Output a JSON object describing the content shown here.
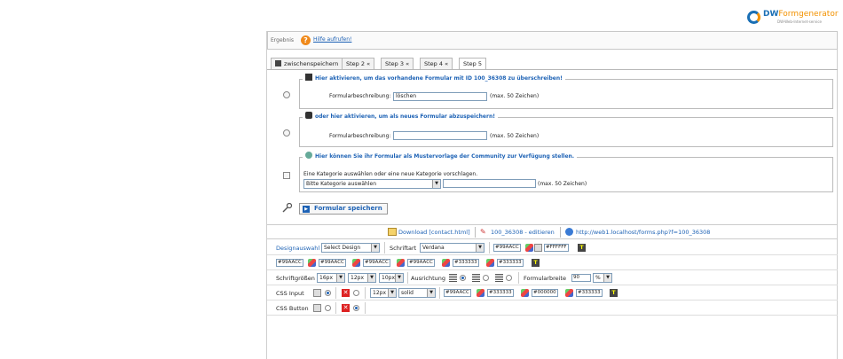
{
  "logo": {
    "brand_a": "DW",
    "brand_b": "Formgenerator",
    "tagline": "DW-Web-Internet-service"
  },
  "result": {
    "label": "Ergebnis",
    "help_link": "Hilfe aufrufen!"
  },
  "tabs": [
    {
      "label": "zwischenspeichern",
      "active": false
    },
    {
      "label": "Step 2 «",
      "active": false
    },
    {
      "label": "Step 3 «",
      "active": false
    },
    {
      "label": "Step 4 «",
      "active": false
    },
    {
      "label": "Step 5",
      "active": true
    }
  ],
  "section_overwrite": {
    "title": "Hier aktivieren, um das vorhandene Formular mit ID 100_36308 zu überschreiben!",
    "field_label": "Formularbeschreibung:",
    "field_value": "löschen",
    "hint": "(max. 50 Zeichen)"
  },
  "section_new": {
    "title": "oder hier aktivieren, um als neues Formular abzuspeichern!",
    "field_label": "Formularbeschreibung:",
    "field_value": "",
    "hint": "(max. 50 Zeichen)"
  },
  "section_community": {
    "title": "Hier können Sie ihr Formular als Mustervorlage der Community zur Verfügung stellen.",
    "desc": "Eine Kategorie auswählen oder eine neue Kategorie vorschlagen.",
    "category_selected": "Bitte Kategorie auswählen",
    "new_category_value": "",
    "hint": "(max. 50 Zeichen)"
  },
  "save_button": "Formular speichern",
  "actions": {
    "download": "Download [contact.html]",
    "edit": "100_36308 - editieren",
    "url": "http://web1.localhost/forms.php?f=100_36308"
  },
  "design_row": {
    "label": "Designauswahl",
    "design_select": "Select Design",
    "font_label": "Schriftart",
    "font_select": "Verdana",
    "color1": "#99AACC",
    "color2": "#FFFFFF"
  },
  "color_row": [
    "#99AACC",
    "#99AACC",
    "#99AACC",
    "#99AACC",
    "#333333",
    "#333333"
  ],
  "size_row": {
    "label": "Schriftgrößen",
    "s1": "16px",
    "s2": "12px",
    "s3": "10px",
    "align_label": "Ausrichtung",
    "width_label": "Formularbreite",
    "width_value": "90",
    "width_unit": "%"
  },
  "css_input": {
    "label": "CSS Input",
    "size": "12px",
    "style": "solid",
    "c1": "#99AACC",
    "c2": "#333333",
    "c3": "#000000",
    "c4": "#333333"
  },
  "css_button": {
    "label": "CSS Button"
  }
}
